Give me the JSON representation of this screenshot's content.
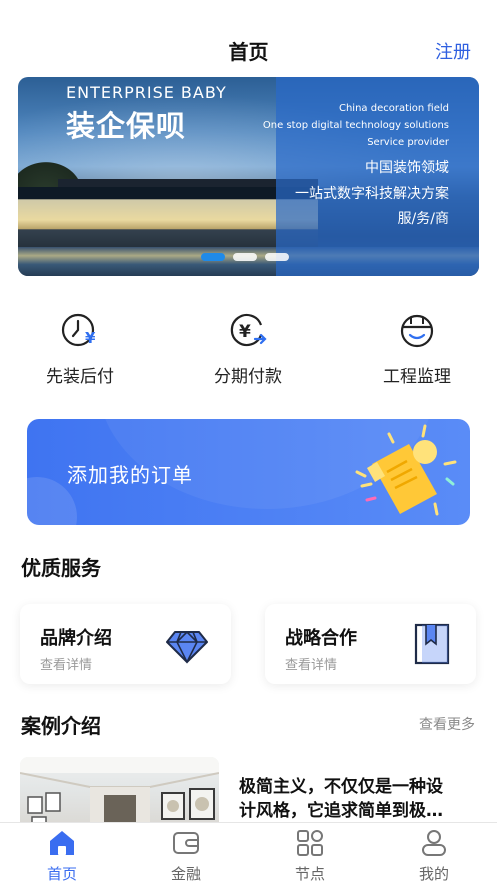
{
  "header": {
    "title": "首页",
    "register_label": "注册"
  },
  "banner": {
    "headline_en": "ENTERPRISE BABY",
    "headline_cn": "装企保呗",
    "right_lines": [
      "China decoration field",
      "One stop digital technology solutions",
      "Service provider",
      "中国装饰领域",
      "一站式数字科技解决方案",
      "服/务/商"
    ],
    "slide_count": 3,
    "active_slide": 1
  },
  "quick_actions": [
    {
      "label": "先装后付",
      "icon": "clock-yuan-icon"
    },
    {
      "label": "分期付款",
      "icon": "yuan-cycle-icon"
    },
    {
      "label": "工程监理",
      "icon": "hardhat-icon"
    }
  ],
  "order_card": {
    "label": "添加我的订单",
    "icon": "receipt-illustration"
  },
  "services": {
    "title": "优质服务",
    "cards": [
      {
        "name": "品牌介绍",
        "sub": "查看详情",
        "icon": "diamond-icon"
      },
      {
        "name": "战略合作",
        "sub": "查看详情",
        "icon": "bookmark-book-icon"
      }
    ]
  },
  "cases": {
    "title": "案例介绍",
    "more_label": "查看更多",
    "first_text_line1": "极简主义，不仅仅是一种设",
    "first_text_line2": "计风格，它追求简单到极…"
  },
  "tabbar": [
    {
      "label": "首页",
      "icon": "home-icon",
      "active": true
    },
    {
      "label": "金融",
      "icon": "wallet-icon",
      "active": false
    },
    {
      "label": "节点",
      "icon": "grid-nodes-icon",
      "active": false
    },
    {
      "label": "我的",
      "icon": "user-icon",
      "active": false
    }
  ],
  "colors": {
    "accent": "#3a6df0",
    "banner_panel": "#2a69c8",
    "order_card": "#4a7ff3"
  }
}
